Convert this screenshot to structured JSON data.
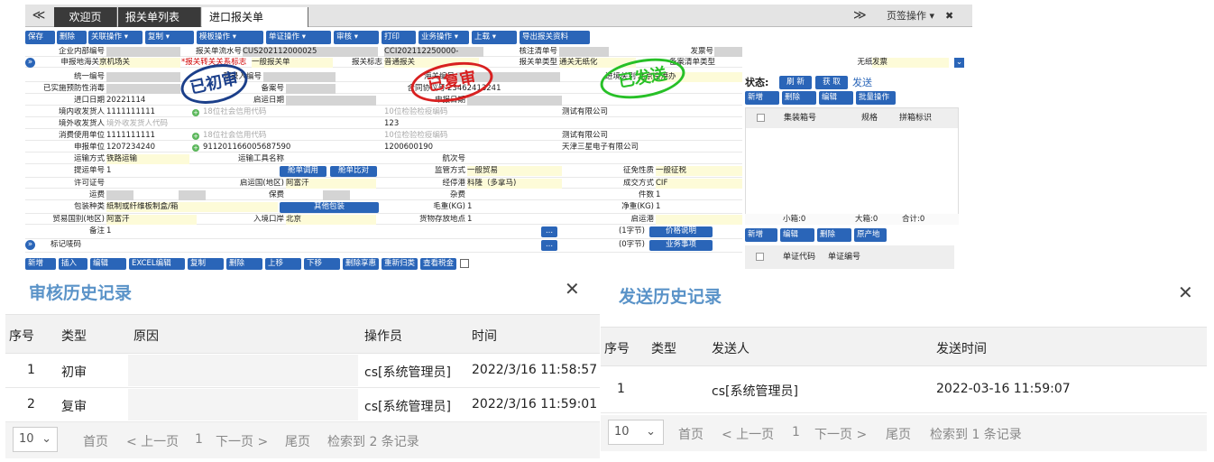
{
  "tabs": {
    "nav": "≪",
    "items": [
      {
        "label": "欢迎页"
      },
      {
        "label": "报关单列表",
        "close": "✖"
      },
      {
        "label": "进口报关单0025",
        "close": "✖"
      }
    ],
    "more": "≫",
    "page_ops": "页签操作 ▾",
    "close_all": "✖"
  },
  "toolbar": [
    "保存",
    "删除",
    "关联操作 ▾",
    "复制 ▾",
    "模板操作 ▾",
    "单证操作 ▾",
    "审核 ▾",
    "打印",
    "业务操作 ▾",
    "上载 ▾",
    "导出报关资料"
  ],
  "form": {
    "r1": {
      "l1": "企业内部编号",
      "l2": "报关单流水号",
      "v2": "CUS202112000025",
      "v3": "CCI202112250000-",
      "l4": "核注清单号",
      "l5": "发票号",
      "l6": "装箱单号"
    },
    "r2": {
      "l1": "申报地海关",
      "v1": "京机场关",
      "v2a": "*报关转关关系标志",
      "v2": "一般报关单",
      "l3": "报关标志",
      "v3": "普通报关",
      "l4": "报关单类型",
      "v4": "通关无纸化",
      "l5": "备案清单类型",
      "l6": "无纸化申证",
      "v6": "发票"
    },
    "r3": {
      "l1": "统一编号",
      "l2": "预录入编号",
      "l3": "海关编号",
      "l4": "进境关别",
      "v4": "北京空港办"
    },
    "r4": {
      "l1": "已实施预防性消毒",
      "l2": "备案号",
      "l3": "合同协议号",
      "v3": "23462413241"
    },
    "r5": {
      "l1": "进口日期",
      "v1": "20221114",
      "l2": "启运日期",
      "l3": "申报日期"
    },
    "r6": {
      "l1": "境内收发货人",
      "v1": "1111111111",
      "p2": "18位社会信用代码",
      "p3": "10位检验检疫编码",
      "v4": "测试有限公司"
    },
    "r7": {
      "l1": "境外收发货人",
      "p1": "境外收发货人代码",
      "v3": "123"
    },
    "r8": {
      "l1": "消费使用单位",
      "v1": "1111111111",
      "p2": "18位社会信用代码",
      "p3": "10位检验检疫编码",
      "v4": "测试有限公司"
    },
    "r9": {
      "l1": "申报单位",
      "v1": "1207234240",
      "v2": "911201166005687590",
      "v3": "1200600190",
      "v4": "天津三星电子有限公司"
    },
    "r10": {
      "l1": "运输方式",
      "v1": "铁路运输",
      "l2": "运输工具名称",
      "l3": "航次号"
    },
    "r11": {
      "l1": "提运单号",
      "v1": "1",
      "b1": "舱单调用",
      "b2": "舱单比对",
      "l3": "监管方式",
      "v3": "一般贸易",
      "l4": "征免性质",
      "v4": "一般征税"
    },
    "r12": {
      "l1": "许可证号",
      "l2": "启运国(地区)",
      "v2": "阿富汗",
      "l3": "经停港",
      "v3": "科隆（多拿马)",
      "l4": "成交方式",
      "v4": "CIF"
    },
    "r13": {
      "l1": "运费",
      "l2": "保费",
      "l3": "杂费",
      "l4": "件数",
      "v4": "1"
    },
    "r14": {
      "l1": "包装种类",
      "v1": "纸制或纤维板制盒/箱",
      "b1": "其他包装",
      "l3": "毛重(KG)",
      "v3": "1",
      "l4": "净重(KG)",
      "v4": "1"
    },
    "r15": {
      "l1": "贸易国别(地区)",
      "v1": "阿富汗",
      "l2": "入境口岸",
      "v2": "北京",
      "l3": "货物存放地点",
      "v3": "1",
      "l4": "启运港"
    },
    "r16": {
      "l1": "备注",
      "v1": "1",
      "dots": "...",
      "l4": "(1字节)",
      "b4": "价格说明"
    },
    "r17": {
      "l1": "标记唛码",
      "dots": "...",
      "l4": "(0字节)",
      "b4": "业务事项"
    }
  },
  "row_toolbar": [
    "新增",
    "插入",
    "编辑",
    "EXCEL编辑",
    "复制",
    "删除",
    "上移",
    "下移",
    "删除享惠",
    "重新归类",
    "查看税金"
  ],
  "stamps": {
    "s1": "已初审",
    "s2": "已复审",
    "s3": "已发送"
  },
  "status": {
    "label": "状态:",
    "refresh": "刷 新",
    "fetch": "获 取",
    "state": "发送"
  },
  "box": {
    "toolbar": [
      "新增",
      "删除",
      "编辑",
      "批量操作"
    ],
    "cols": [
      "集装箱号",
      "规格",
      "拼箱标识"
    ],
    "footer": [
      "小箱:0",
      "大箱:0",
      "合计:0"
    ]
  },
  "cert": {
    "toolbar": [
      "新增",
      "编辑",
      "删除",
      "原产地"
    ],
    "cols": [
      "单证代码",
      "单证编号"
    ]
  },
  "audit": {
    "title": "审核历史记录",
    "close": "✕",
    "cols": [
      "序号",
      "类型",
      "原因",
      "操作员",
      "时间"
    ],
    "rows": [
      [
        "1",
        "初审",
        "",
        "cs[系统管理员]",
        "2022/3/16 11:58:57"
      ],
      [
        "2",
        "复审",
        "",
        "cs[系统管理员]",
        "2022/3/16 11:59:01"
      ]
    ],
    "pager": {
      "size": "10",
      "first": "首页",
      "prev": "< 上一页",
      "page": "1",
      "next": "下一页 >",
      "last": "尾页",
      "total": "检索到 2 条记录"
    }
  },
  "send": {
    "title": "发送历史记录",
    "close": "✕",
    "cols": [
      "序号",
      "类型",
      "发送人",
      "发送时间"
    ],
    "rows": [
      [
        "1",
        "",
        "cs[系统管理员]",
        "2022-03-16 11:59:07"
      ]
    ],
    "pager": {
      "size": "10",
      "first": "首页",
      "prev": "< 上一页",
      "page": "1",
      "next": "下一页 >",
      "last": "尾页",
      "total": "检索到 1 条记录"
    }
  }
}
